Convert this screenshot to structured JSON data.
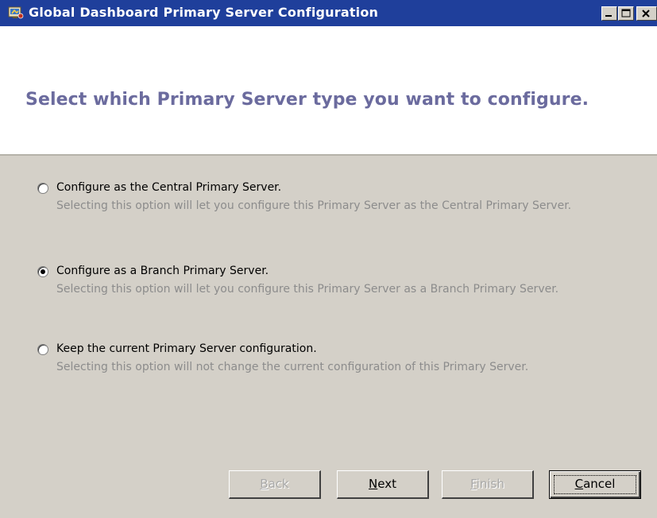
{
  "window": {
    "title": "Global Dashboard Primary Server Configuration",
    "colors": {
      "titlebar": "#1f3f9b",
      "heading": "#6b6b9e",
      "dialog_bg": "#d4d0c8",
      "description": "#8c8c8c"
    },
    "controls": {
      "minimize_icon": "minimize-icon",
      "maximize_icon": "maximize-icon",
      "close_icon": "close-icon"
    }
  },
  "header": {
    "title": "Select which Primary Server type you want to configure."
  },
  "options": [
    {
      "label": "Configure as the Central Primary Server.",
      "description": "Selecting this option will let you configure this Primary Server as the Central Primary Server.",
      "selected": false
    },
    {
      "label": "Configure as a Branch Primary Server.",
      "description": "Selecting this option will let you configure this Primary Server as a Branch Primary Server.",
      "selected": true
    },
    {
      "label": "Keep the current Primary Server configuration.",
      "description": "Selecting this option will not change the current configuration of this Primary Server.",
      "selected": false
    }
  ],
  "buttons": {
    "back": {
      "accel": "B",
      "rest": "ack",
      "enabled": false
    },
    "next": {
      "accel": "N",
      "rest": "ext",
      "enabled": true
    },
    "finish": {
      "accel": "F",
      "rest": "inish",
      "enabled": false
    },
    "cancel": {
      "accel": "C",
      "rest": "ancel",
      "enabled": true,
      "focused": true
    }
  }
}
